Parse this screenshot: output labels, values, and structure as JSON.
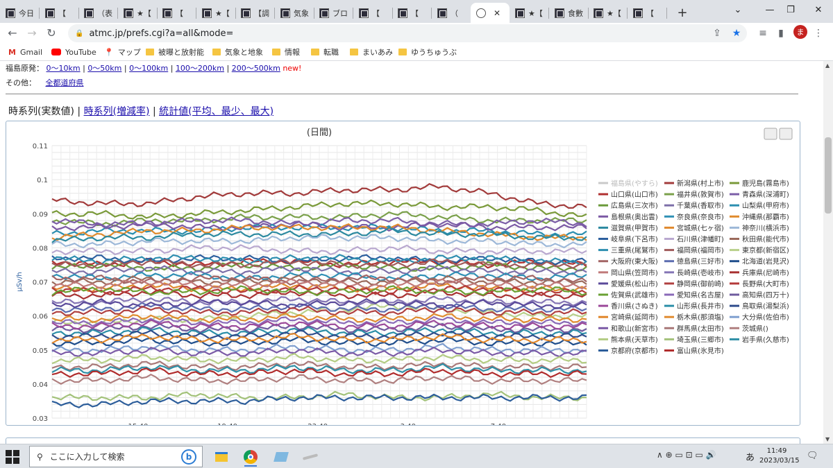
{
  "tabs": [
    {
      "label": "今日",
      "icon": "site-icon"
    },
    {
      "label": "【",
      "icon": "site-icon"
    },
    {
      "label": "（表",
      "icon": "site-icon"
    },
    {
      "label": "★【",
      "icon": "site-icon"
    },
    {
      "label": "【",
      "icon": "site-icon"
    },
    {
      "label": "★【",
      "icon": "site-icon"
    },
    {
      "label": "【調",
      "icon": "site-icon"
    },
    {
      "label": "気象",
      "icon": "twitter-icon"
    },
    {
      "label": "ブロ",
      "icon": "info-icon"
    },
    {
      "label": "【",
      "icon": "site-icon"
    },
    {
      "label": "【",
      "icon": "site-icon"
    },
    {
      "label": "（",
      "icon": "site-icon"
    },
    {
      "label": "",
      "icon": "globe-icon",
      "active": true
    },
    {
      "label": "★【",
      "icon": "site-icon"
    },
    {
      "label": "食數",
      "icon": "site-icon"
    },
    {
      "label": "★【",
      "icon": "site-icon"
    },
    {
      "label": "【",
      "icon": "site-icon"
    }
  ],
  "window": {
    "minimize": "—",
    "maximize": "❐",
    "close": "✕",
    "dropdown": "⌄"
  },
  "address": {
    "url": "atmc.jp/prefs.cgi?a=all&mode=",
    "avatar": "ま"
  },
  "bookmarks": [
    {
      "label": "Gmail",
      "icon": "gmail-icon"
    },
    {
      "label": "YouTube",
      "icon": "youtube-icon"
    },
    {
      "label": "マップ",
      "icon": "maps-icon"
    },
    {
      "label": "被曝と放射能",
      "icon": "folder-icon"
    },
    {
      "label": "気象と地象",
      "icon": "folder-icon"
    },
    {
      "label": "情報",
      "icon": "folder-icon"
    },
    {
      "label": "転職",
      "icon": "folder-icon"
    },
    {
      "label": "まいあみ",
      "icon": "folder-icon"
    },
    {
      "label": "ゆうちゅうぶ",
      "icon": "folder-icon"
    }
  ],
  "page": {
    "fukushima_label": "福島原発：",
    "fukushima_links": [
      "0～10km",
      "0～50km",
      "0～100km",
      "100～200km",
      "200～500km"
    ],
    "fukushima_sep": "|",
    "new_badge": "new!",
    "other_label": "その他：",
    "other_link": "全都道府県",
    "subnav": {
      "plain": "時系列(実数値)",
      "sep": "|",
      "link1": "時系列(増減率)",
      "link2": "統計値(平均、最少、最大)"
    }
  },
  "chart_data": {
    "type": "line",
    "title": "(日間)",
    "ylabel": "μSv/h",
    "xlabel": "",
    "ylim": [
      0.03,
      0.11
    ],
    "yticks": [
      "0.03",
      "0.04",
      "0.05",
      "0.06",
      "0.07",
      "0.08",
      "0.09",
      "0.1",
      "0.11"
    ],
    "xticks": [
      "15:40",
      "19:40",
      "23:40",
      "3:40",
      "7:40"
    ],
    "grid": true,
    "legend_position": "right",
    "series": [
      {
        "name": "福島県(やすら)",
        "color": "#c9c9c9",
        "values": []
      },
      {
        "name": "新潟県(村上市)",
        "color": "#a23b3b",
        "values": [
          0.094,
          0.093,
          0.093,
          0.095,
          0.096,
          0.096,
          0.097,
          0.097,
          0.098,
          0.096,
          0.093,
          0.092
        ]
      },
      {
        "name": "鹿児島(霧島市)",
        "color": "#7a9a3a",
        "values": [
          0.09,
          0.09,
          0.089,
          0.09,
          0.091,
          0.092,
          0.093,
          0.093,
          0.092,
          0.092,
          0.091,
          0.089
        ]
      },
      {
        "name": "山口県(山口市)",
        "color": "#b03030",
        "values": [
          0.076,
          0.075,
          0.076,
          0.075,
          0.076,
          0.076,
          0.075,
          0.076,
          0.076,
          0.075,
          0.076,
          0.075
        ]
      },
      {
        "name": "福井県(敦賀市)",
        "color": "#7aa04a",
        "values": [
          0.088,
          0.087,
          0.088,
          0.088,
          0.089,
          0.089,
          0.089,
          0.09,
          0.089,
          0.088,
          0.088,
          0.088
        ]
      },
      {
        "name": "青森県(深浦町)",
        "color": "#7b5ea7",
        "values": [
          0.088,
          0.087,
          0.087,
          0.088,
          0.088,
          0.087,
          0.088,
          0.088,
          0.087,
          0.087,
          0.088,
          0.087
        ]
      },
      {
        "name": "広島県(三次市)",
        "color": "#6a9a3a",
        "values": [
          0.074,
          0.075,
          0.074,
          0.074,
          0.075,
          0.074,
          0.075,
          0.074,
          0.074,
          0.075,
          0.074,
          0.074
        ]
      },
      {
        "name": "千葉県(香取市)",
        "color": "#7c6fa8",
        "values": [
          0.073,
          0.073,
          0.074,
          0.073,
          0.073,
          0.074,
          0.073,
          0.073,
          0.074,
          0.073,
          0.073,
          0.073
        ]
      },
      {
        "name": "山梨県(甲府市)",
        "color": "#2b8fb0",
        "values": [
          0.084,
          0.085,
          0.085,
          0.085,
          0.086,
          0.086,
          0.086,
          0.086,
          0.085,
          0.085,
          0.084,
          0.084
        ]
      },
      {
        "name": "島根県(奥出雲)",
        "color": "#7b59a4",
        "values": [
          0.086,
          0.086,
          0.087,
          0.086,
          0.086,
          0.087,
          0.086,
          0.086,
          0.087,
          0.086,
          0.086,
          0.086
        ]
      },
      {
        "name": "奈良県(奈良市)",
        "color": "#2f90b5",
        "values": [
          0.072,
          0.071,
          0.072,
          0.072,
          0.071,
          0.072,
          0.072,
          0.071,
          0.072,
          0.072,
          0.071,
          0.072
        ]
      },
      {
        "name": "沖縄県(那覇市)",
        "color": "#e08a2c",
        "values": [
          0.083,
          0.084,
          0.085,
          0.085,
          0.086,
          0.086,
          0.086,
          0.086,
          0.085,
          0.084,
          0.083,
          0.083
        ]
      },
      {
        "name": "滋賀県(甲賀市)",
        "color": "#2c8aa0",
        "values": [
          0.082,
          0.083,
          0.083,
          0.084,
          0.084,
          0.084,
          0.084,
          0.085,
          0.084,
          0.084,
          0.083,
          0.083
        ]
      },
      {
        "name": "宮城県(七ヶ宿)",
        "color": "#e0892e",
        "values": [
          0.068,
          0.068,
          0.069,
          0.068,
          0.068,
          0.069,
          0.068,
          0.068,
          0.069,
          0.068,
          0.068,
          0.068
        ]
      },
      {
        "name": "神奈川(横浜市)",
        "color": "#9db8d8",
        "values": [
          0.081,
          0.081,
          0.082,
          0.082,
          0.082,
          0.083,
          0.083,
          0.083,
          0.082,
          0.082,
          0.081,
          0.081
        ]
      },
      {
        "name": "岐阜県(下呂市)",
        "color": "#2c5f9e",
        "values": [
          0.077,
          0.077,
          0.076,
          0.077,
          0.077,
          0.076,
          0.077,
          0.077,
          0.076,
          0.077,
          0.076,
          0.076
        ]
      },
      {
        "name": "石川県(津幡町)",
        "color": "#b9a8cf",
        "values": [
          0.079,
          0.079,
          0.079,
          0.08,
          0.08,
          0.079,
          0.079,
          0.08,
          0.079,
          0.079,
          0.079,
          0.079
        ]
      },
      {
        "name": "秋田県(能代市)",
        "color": "#9b6a5b",
        "values": [
          0.07,
          0.07,
          0.071,
          0.07,
          0.07,
          0.071,
          0.07,
          0.07,
          0.071,
          0.07,
          0.07,
          0.07
        ]
      },
      {
        "name": "三重県(尾鷲市)",
        "color": "#2e8fb0",
        "values": [
          0.077,
          0.076,
          0.077,
          0.077,
          0.076,
          0.077,
          0.077,
          0.076,
          0.077,
          0.077,
          0.076,
          0.076
        ]
      },
      {
        "name": "福岡県(福岡市)",
        "color": "#a05a5a",
        "values": [
          0.075,
          0.075,
          0.076,
          0.075,
          0.075,
          0.076,
          0.075,
          0.075,
          0.076,
          0.075,
          0.075,
          0.075
        ]
      },
      {
        "name": "東京都(新宿区)",
        "color": "#b8d08a",
        "values": [
          0.058,
          0.058,
          0.059,
          0.059,
          0.06,
          0.061,
          0.062,
          0.063,
          0.062,
          0.061,
          0.06,
          0.06
        ]
      },
      {
        "name": "大阪府(東大阪)",
        "color": "#a36565",
        "values": [
          0.071,
          0.071,
          0.07,
          0.071,
          0.071,
          0.07,
          0.071,
          0.071,
          0.07,
          0.071,
          0.071,
          0.07
        ]
      },
      {
        "name": "徳島県(三好市)",
        "color": "#5c6db0",
        "values": [
          0.062,
          0.062,
          0.063,
          0.062,
          0.062,
          0.063,
          0.062,
          0.062,
          0.063,
          0.062,
          0.062,
          0.062
        ]
      },
      {
        "name": "北海道(岩見沢)",
        "color": "#1f4e8c",
        "values": [
          0.052,
          0.052,
          0.053,
          0.052,
          0.052,
          0.053,
          0.052,
          0.052,
          0.053,
          0.052,
          0.052,
          0.052
        ]
      },
      {
        "name": "岡山県(笠岡市)",
        "color": "#c07a7a",
        "values": [
          0.069,
          0.069,
          0.07,
          0.069,
          0.069,
          0.07,
          0.069,
          0.069,
          0.07,
          0.069,
          0.069,
          0.069
        ]
      },
      {
        "name": "長崎県(壱岐市)",
        "color": "#8575b5",
        "values": [
          0.064,
          0.064,
          0.065,
          0.064,
          0.064,
          0.065,
          0.064,
          0.064,
          0.065,
          0.064,
          0.064,
          0.064
        ]
      },
      {
        "name": "兵庫県(尼崎市)",
        "color": "#a83232",
        "values": [
          0.066,
          0.066,
          0.067,
          0.066,
          0.066,
          0.067,
          0.066,
          0.066,
          0.067,
          0.066,
          0.066,
          0.066
        ]
      },
      {
        "name": "愛媛県(松山市)",
        "color": "#5a4a9a",
        "values": [
          0.063,
          0.064,
          0.063,
          0.064,
          0.064,
          0.063,
          0.064,
          0.064,
          0.063,
          0.064,
          0.063,
          0.063
        ]
      },
      {
        "name": "静岡県(御前崎)",
        "color": "#b04040",
        "values": [
          0.061,
          0.061,
          0.062,
          0.061,
          0.061,
          0.062,
          0.061,
          0.061,
          0.062,
          0.061,
          0.061,
          0.061
        ]
      },
      {
        "name": "長野県(大町市)",
        "color": "#b43a3a",
        "values": [
          0.068,
          0.067,
          0.068,
          0.068,
          0.067,
          0.068,
          0.068,
          0.067,
          0.068,
          0.068,
          0.067,
          0.067
        ]
      },
      {
        "name": "佐賀県(武雄市)",
        "color": "#6aa033",
        "values": [
          0.067,
          0.068,
          0.067,
          0.067,
          0.068,
          0.067,
          0.067,
          0.068,
          0.067,
          0.067,
          0.068,
          0.067
        ]
      },
      {
        "name": "愛知県(名古屋)",
        "color": "#8a6ab8",
        "values": [
          0.058,
          0.058,
          0.059,
          0.058,
          0.058,
          0.059,
          0.058,
          0.058,
          0.059,
          0.058,
          0.058,
          0.058
        ]
      },
      {
        "name": "高知県(四万十)",
        "color": "#6e5b9e",
        "values": [
          0.056,
          0.056,
          0.057,
          0.056,
          0.056,
          0.057,
          0.056,
          0.056,
          0.057,
          0.056,
          0.056,
          0.056
        ]
      },
      {
        "name": "香川県(さぬき)",
        "color": "#9c4a9a",
        "values": [
          0.057,
          0.057,
          0.058,
          0.057,
          0.057,
          0.058,
          0.057,
          0.057,
          0.058,
          0.057,
          0.057,
          0.057
        ]
      },
      {
        "name": "山形県(長井市)",
        "color": "#2b8fa8",
        "values": [
          0.055,
          0.055,
          0.056,
          0.055,
          0.055,
          0.056,
          0.055,
          0.055,
          0.056,
          0.055,
          0.055,
          0.055
        ]
      },
      {
        "name": "鳥取県(湯梨浜)",
        "color": "#2f4d8c",
        "values": [
          0.054,
          0.054,
          0.055,
          0.054,
          0.054,
          0.055,
          0.054,
          0.054,
          0.055,
          0.054,
          0.054,
          0.054
        ]
      },
      {
        "name": "宮崎県(延岡市)",
        "color": "#e0862a",
        "values": [
          0.053,
          0.053,
          0.054,
          0.053,
          0.053,
          0.054,
          0.053,
          0.053,
          0.054,
          0.053,
          0.053,
          0.053
        ]
      },
      {
        "name": "栃木県(那須塩)",
        "color": "#e08c30",
        "values": [
          0.059,
          0.059,
          0.06,
          0.059,
          0.059,
          0.06,
          0.059,
          0.059,
          0.06,
          0.059,
          0.059,
          0.059
        ]
      },
      {
        "name": "大分県(佐伯市)",
        "color": "#7f9fcf",
        "values": [
          0.05,
          0.05,
          0.051,
          0.05,
          0.05,
          0.051,
          0.05,
          0.05,
          0.051,
          0.05,
          0.05,
          0.05
        ]
      },
      {
        "name": "和歌山(新宮市)",
        "color": "#7b5aa6",
        "values": [
          0.049,
          0.049,
          0.05,
          0.049,
          0.049,
          0.05,
          0.049,
          0.049,
          0.05,
          0.049,
          0.049,
          0.049
        ]
      },
      {
        "name": "群馬県(太田市)",
        "color": "#a87878",
        "values": [
          0.045,
          0.045,
          0.046,
          0.045,
          0.045,
          0.046,
          0.045,
          0.045,
          0.046,
          0.045,
          0.045,
          0.045
        ]
      },
      {
        "name": "茨城県()",
        "color": "#b08080",
        "values": [
          0.041,
          0.041,
          0.042,
          0.041,
          0.041,
          0.042,
          0.041,
          0.041,
          0.042,
          0.041,
          0.041,
          0.041
        ]
      },
      {
        "name": "熊本県(天草市)",
        "color": "#b3cc83",
        "values": [
          0.047,
          0.047,
          0.048,
          0.047,
          0.047,
          0.048,
          0.047,
          0.047,
          0.048,
          0.047,
          0.047,
          0.047
        ]
      },
      {
        "name": "埼玉県(三郷市)",
        "color": "#a3c27a",
        "values": [
          0.036,
          0.036,
          0.036,
          0.037,
          0.036,
          0.036,
          0.037,
          0.036,
          0.036,
          0.037,
          0.036,
          0.036
        ]
      },
      {
        "name": "岩手県(久慈市)",
        "color": "#2e8fa6",
        "values": [
          0.044,
          0.044,
          0.045,
          0.044,
          0.044,
          0.045,
          0.044,
          0.044,
          0.045,
          0.044,
          0.044,
          0.044
        ]
      },
      {
        "name": "京都府(京都市)",
        "color": "#2c5d9a",
        "values": [
          0.034,
          0.034,
          0.035,
          0.035,
          0.035,
          0.036,
          0.036,
          0.036,
          0.036,
          0.036,
          0.036,
          0.036
        ]
      },
      {
        "name": "富山県(氷見市)",
        "color": "#b02c2c",
        "values": [
          0.043,
          0.043,
          0.044,
          0.043,
          0.043,
          0.044,
          0.043,
          0.043,
          0.044,
          0.043,
          0.043,
          0.043
        ]
      }
    ]
  },
  "taskbar": {
    "search_placeholder": "ここに入力して検索",
    "bing": "b",
    "time": "11:49",
    "date": "2023/03/15",
    "ime": "あ",
    "tray_icons": "∧ ⊕ ▭ ⊡ ▭ 🔊"
  }
}
